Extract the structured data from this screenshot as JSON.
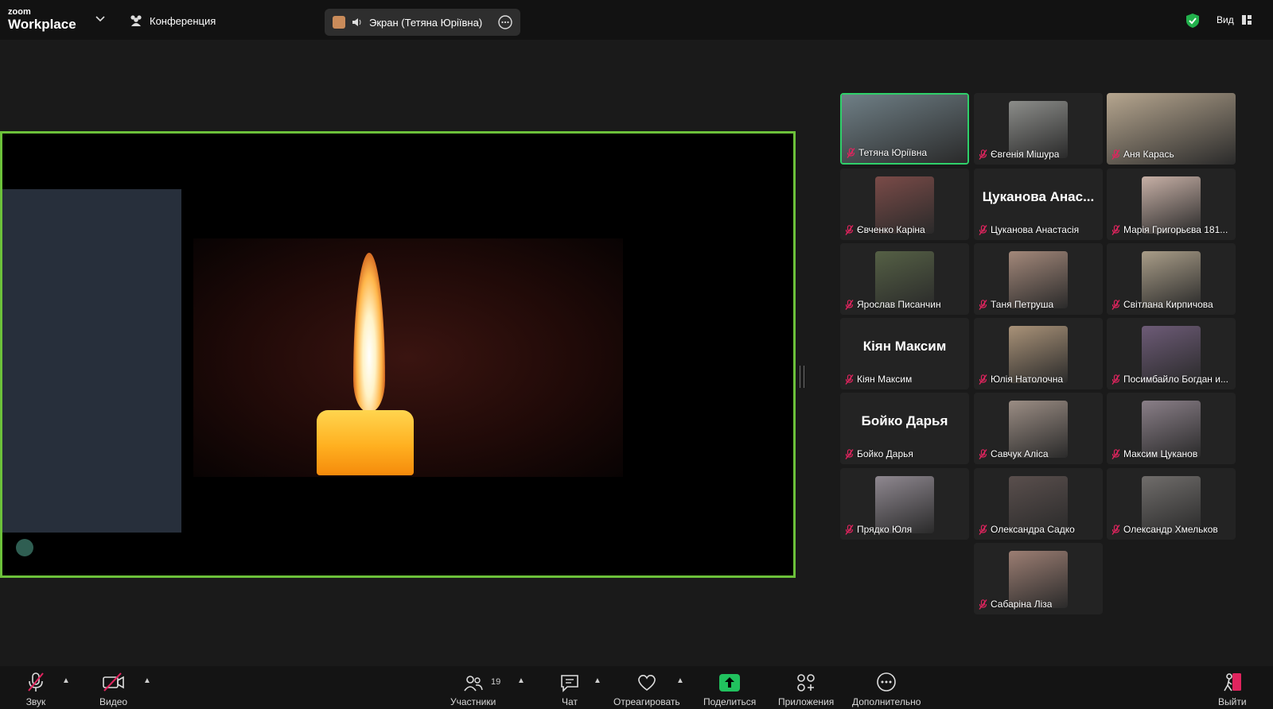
{
  "app": {
    "logo_small": "zoom",
    "logo_big": "Workplace"
  },
  "header": {
    "conference_label": "Конференция",
    "screen_share_label": "Экран (Тетяна Юріївна)",
    "view_label": "Вид"
  },
  "participants": [
    {
      "label": "Тетяна Юріївна",
      "active": true,
      "photo_color": "#6f7f86"
    },
    {
      "label": "Євгенія Мішура",
      "photo_color": "#8c8d8a"
    },
    {
      "label": "Аня Карась",
      "photo_color": "#b6a68f"
    },
    {
      "label": "Євченко Каріна",
      "photo_color": "#7a4b48"
    },
    {
      "label": "Цуканова Анастасія",
      "big_name": "Цуканова Анас..."
    },
    {
      "label": "Марія Григорьєва 181...",
      "photo_color": "#c7b0a6"
    },
    {
      "label": "Ярослав Писанчин",
      "photo_color": "#556045"
    },
    {
      "label": "Таня Петруша",
      "photo_color": "#a3887a"
    },
    {
      "label": "Світлана Кирпичова",
      "photo_color": "#a99d88"
    },
    {
      "label": "Кіян Максим",
      "big_name": "Кіян Максим"
    },
    {
      "label": "Юлія Натолочна",
      "photo_color": "#a99278"
    },
    {
      "label": "Посимбайло Богдан и...",
      "photo_color": "#6d5b77"
    },
    {
      "label": "Бойко Дарья",
      "big_name": "Бойко Дарья"
    },
    {
      "label": "Савчук Аліса",
      "photo_color": "#9b8d84"
    },
    {
      "label": "Максим Цуканов",
      "photo_color": "#8a7f88"
    },
    {
      "label": "Прядко Юля",
      "photo_color": "#8f8890"
    },
    {
      "label": "Олександра Садко",
      "photo_color": "#5a4f4d"
    },
    {
      "label": "Олександр Хмельков",
      "photo_color": "#706d6b"
    },
    {
      "label": "Сабаріна Ліза",
      "photo_color": "#9c7e73"
    }
  ],
  "toolbar": {
    "audio": "Звук",
    "video": "Видео",
    "participants": "Участники",
    "participants_count": "19",
    "chat": "Чат",
    "react": "Отреагировать",
    "share": "Поделиться",
    "apps": "Приложения",
    "more": "Дополнительно",
    "leave": "Выйти"
  },
  "colors": {
    "share_border": "#6cc13a",
    "active_speaker": "#2fd06a",
    "share_button": "#21c15e",
    "muted_icon": "#e0245e"
  }
}
